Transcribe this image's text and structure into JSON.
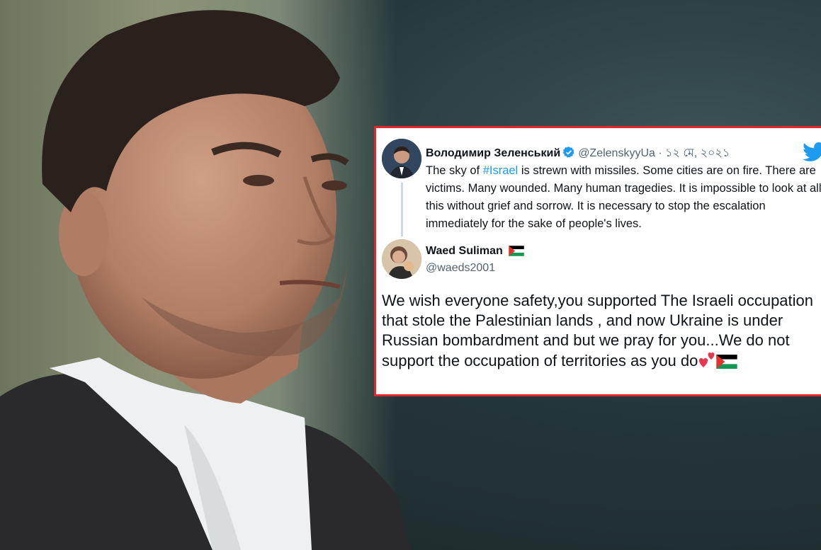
{
  "original_tweet": {
    "display_name": "Володимир Зеленський",
    "handle_and_date": "@ZelenskyyUa · ১২ মে, ২০২১",
    "text_before_hashtag": "The sky of ",
    "hashtag": "#Israel",
    "text_after_hashtag": " is strewn with missiles. Some cities are on fire. There are victims. Many wounded. Many human tragedies. It is impossible to look at all this without grief and sorrow. It is necessary to stop the escalation immediately for the sake of people's lives."
  },
  "reply_tweet": {
    "display_name": "Waed Suliman",
    "handle": "@waeds2001",
    "text": "We wish everyone safety,you supported The Israeli occupation that stole the Palestinian lands , and now Ukraine is under Russian bombardment and but we pray for you...We do not support the occupation of territories as you do"
  },
  "colors": {
    "card_border": "#e0262e",
    "link_blue": "#1d9bf0",
    "verified_blue": "#1d9bf0",
    "twitter_blue": "#1d9bf0"
  },
  "icons": [
    "verified-badge-icon",
    "twitter-bird-icon",
    "palestine-flag-icon",
    "two-hearts-icon"
  ]
}
